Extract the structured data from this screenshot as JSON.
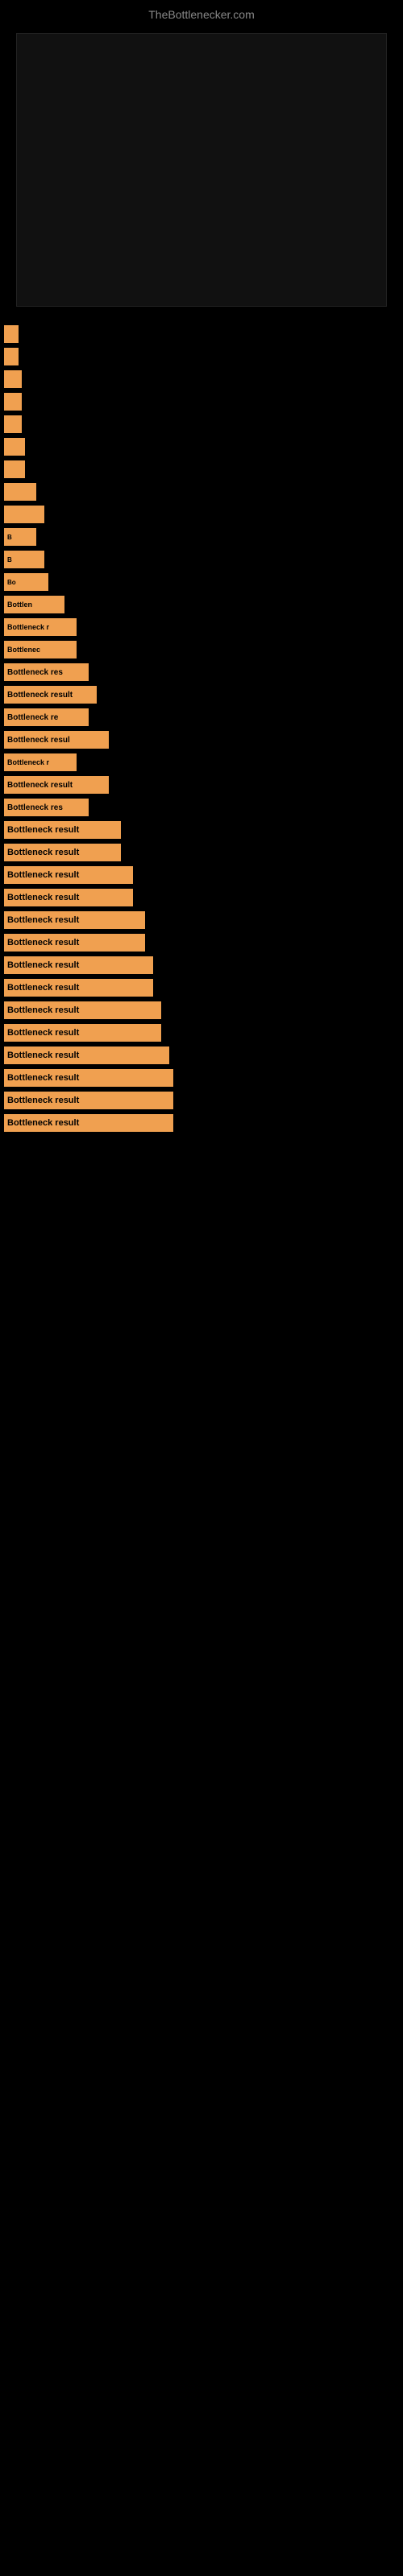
{
  "site": {
    "title": "TheBottlenecker.com"
  },
  "items": [
    {
      "label": "",
      "sizeClass": "tiny1"
    },
    {
      "label": "",
      "sizeClass": "tiny1"
    },
    {
      "label": "",
      "sizeClass": "tiny2"
    },
    {
      "label": "",
      "sizeClass": "tiny2"
    },
    {
      "label": "",
      "sizeClass": "tiny2"
    },
    {
      "label": "",
      "sizeClass": "tiny3"
    },
    {
      "label": "",
      "sizeClass": "tiny3"
    },
    {
      "label": "",
      "sizeClass": "small1"
    },
    {
      "label": "",
      "sizeClass": "small2"
    },
    {
      "label": "B",
      "sizeClass": "small1"
    },
    {
      "label": "B",
      "sizeClass": "small2"
    },
    {
      "label": "Bo",
      "sizeClass": "small3"
    },
    {
      "label": "Bottlen",
      "sizeClass": "medium1"
    },
    {
      "label": "Bottleneck r",
      "sizeClass": "medium2"
    },
    {
      "label": "Bottlenec",
      "sizeClass": "medium2"
    },
    {
      "label": "Bottleneck res",
      "sizeClass": "medium3"
    },
    {
      "label": "Bottleneck result",
      "sizeClass": "medium4"
    },
    {
      "label": "Bottleneck re",
      "sizeClass": "medium3"
    },
    {
      "label": "Bottleneck resul",
      "sizeClass": "large1"
    },
    {
      "label": "Bottleneck r",
      "sizeClass": "medium2"
    },
    {
      "label": "Bottleneck result",
      "sizeClass": "large1"
    },
    {
      "label": "Bottleneck res",
      "sizeClass": "medium3"
    },
    {
      "label": "Bottleneck result",
      "sizeClass": "large2"
    },
    {
      "label": "Bottleneck result",
      "sizeClass": "large2"
    },
    {
      "label": "Bottleneck result",
      "sizeClass": "large3"
    },
    {
      "label": "Bottleneck result",
      "sizeClass": "large3"
    },
    {
      "label": "Bottleneck result",
      "sizeClass": "large4"
    },
    {
      "label": "Bottleneck result",
      "sizeClass": "large4"
    },
    {
      "label": "Bottleneck result",
      "sizeClass": "xlarge1"
    },
    {
      "label": "Bottleneck result",
      "sizeClass": "xlarge1"
    },
    {
      "label": "Bottleneck result",
      "sizeClass": "xlarge2"
    },
    {
      "label": "Bottleneck result",
      "sizeClass": "xlarge2"
    },
    {
      "label": "Bottleneck result",
      "sizeClass": "xlarge3"
    },
    {
      "label": "Bottleneck result",
      "sizeClass": "xlarge4"
    },
    {
      "label": "Bottleneck result",
      "sizeClass": "xlarge4"
    },
    {
      "label": "Bottleneck result",
      "sizeClass": "xlarge4"
    }
  ]
}
